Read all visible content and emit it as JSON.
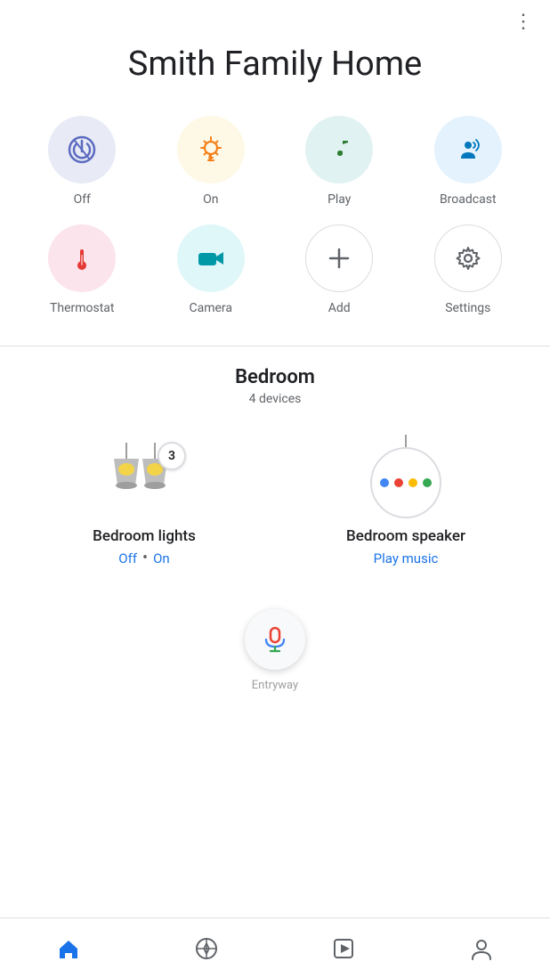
{
  "header": {
    "more_icon": "⋮",
    "title": "Smith Family Home"
  },
  "actions": [
    {
      "id": "off",
      "label": "Off",
      "circle_class": "circle-lavender",
      "icon": "off"
    },
    {
      "id": "on",
      "label": "On",
      "circle_class": "circle-yellow",
      "icon": "on"
    },
    {
      "id": "play",
      "label": "Play",
      "circle_class": "circle-mint",
      "icon": "play"
    },
    {
      "id": "broadcast",
      "label": "Broadcast",
      "circle_class": "circle-lightblue",
      "icon": "broadcast"
    },
    {
      "id": "thermostat",
      "label": "Thermostat",
      "circle_class": "circle-pink",
      "icon": "thermostat"
    },
    {
      "id": "camera",
      "label": "Camera",
      "circle_class": "circle-cyan",
      "icon": "camera"
    },
    {
      "id": "add",
      "label": "Add",
      "circle_class": "circle-white",
      "icon": "add"
    },
    {
      "id": "settings",
      "label": "Settings",
      "circle_class": "circle-white",
      "icon": "settings"
    }
  ],
  "room": {
    "name": "Bedroom",
    "device_count": "4 devices"
  },
  "devices": [
    {
      "id": "bedroom-lights",
      "name": "Bedroom lights",
      "type": "lights",
      "badge": "3",
      "status_type": "toggle",
      "status_off": "Off",
      "status_on": "On",
      "dot": "•"
    },
    {
      "id": "bedroom-speaker",
      "name": "Bedroom speaker",
      "type": "speaker",
      "status_type": "action",
      "action_label": "Play music"
    }
  ],
  "entryway": "Entryway",
  "nav": [
    {
      "id": "home",
      "label": "home",
      "active": true
    },
    {
      "id": "explore",
      "label": "explore",
      "active": false
    },
    {
      "id": "media",
      "label": "media",
      "active": false
    },
    {
      "id": "account",
      "label": "account",
      "active": false
    }
  ],
  "colors": {
    "blue": "#1a73e8",
    "grey": "#5f6368",
    "red": "#ea4335"
  }
}
